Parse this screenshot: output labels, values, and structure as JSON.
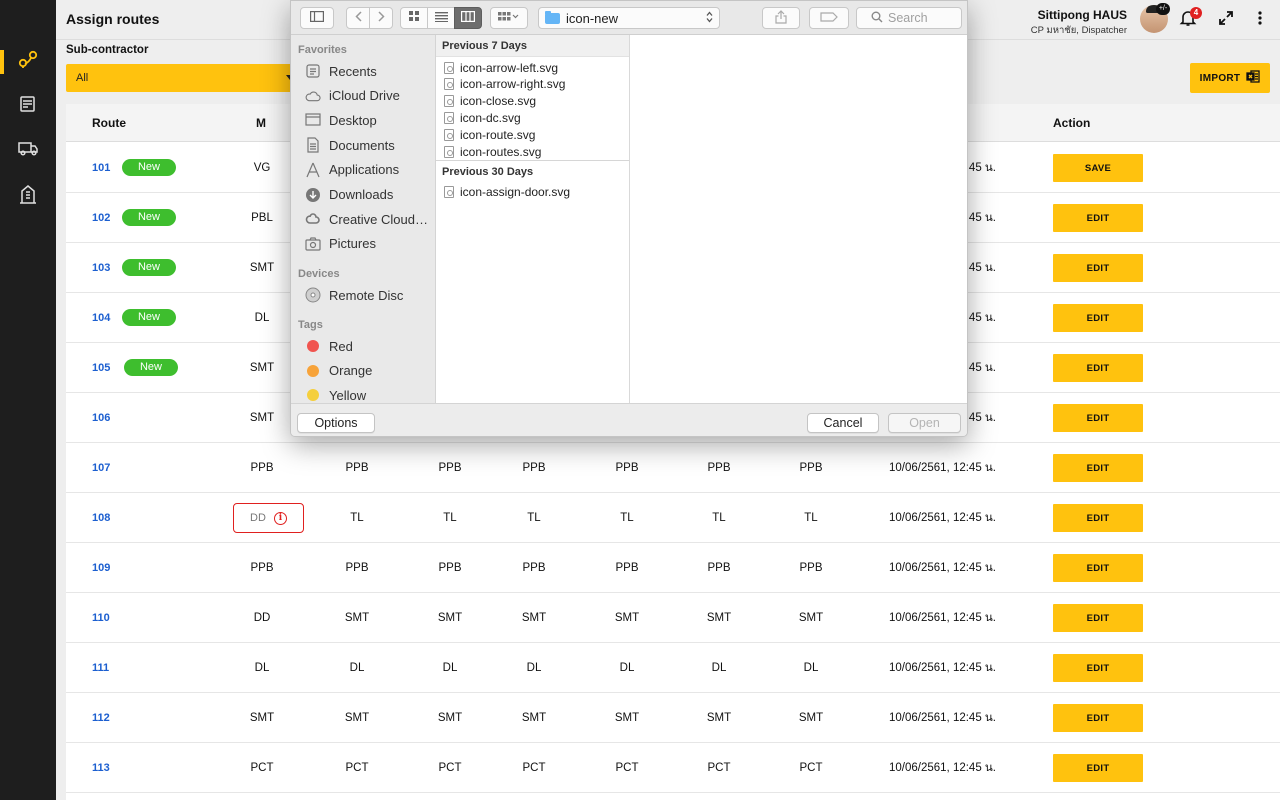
{
  "header": {
    "title": "Assign routes",
    "user_name": "Sittipong HAUS",
    "user_role": "CP มหาชัย, Dispatcher",
    "avatar_badge": "+/-",
    "notification_count": "4"
  },
  "filter": {
    "label": "Sub-contractor",
    "value": "All"
  },
  "import_label": "IMPORT",
  "table": {
    "headers": {
      "route": "Route",
      "m": "M",
      "action": "Action"
    },
    "rows": [
      {
        "route": "101",
        "badge": "New",
        "m": "VG",
        "days": [],
        "time": "10/06/2561, 12:45 น.",
        "action": "SAVE"
      },
      {
        "route": "102",
        "badge": "New",
        "m": "PBL",
        "days": [],
        "time": "10/06/2561, 12:45 น.",
        "action": "EDIT"
      },
      {
        "route": "103",
        "badge": "New",
        "m": "SMT",
        "days": [],
        "time": "10/06/2561, 12:45 น.",
        "action": "EDIT"
      },
      {
        "route": "104",
        "badge": "New",
        "m": "DL",
        "days": [],
        "time": "10/06/2561, 12:45 น.",
        "action": "EDIT"
      },
      {
        "route": "105",
        "badge": "New",
        "m": "SMT",
        "days": [],
        "time": "10/06/2561, 12:45 น.",
        "action": "EDIT"
      },
      {
        "route": "106",
        "badge": "",
        "m": "SMT",
        "days": [],
        "time": "10/06/2561, 12:45 น.",
        "action": "EDIT"
      },
      {
        "route": "107",
        "badge": "",
        "m": "PPB",
        "days": [
          "PPB",
          "PPB",
          "PPB",
          "PPB",
          "PPB",
          "PPB"
        ],
        "time": "10/06/2561, 12:45 น.",
        "action": "EDIT"
      },
      {
        "route": "108",
        "badge": "",
        "m": "DD",
        "error": true,
        "days": [
          "TL",
          "TL",
          "TL",
          "TL",
          "TL",
          "TL"
        ],
        "time": "10/06/2561, 12:45 น.",
        "action": "EDIT"
      },
      {
        "route": "109",
        "badge": "",
        "m": "PPB",
        "days": [
          "PPB",
          "PPB",
          "PPB",
          "PPB",
          "PPB",
          "PPB"
        ],
        "time": "10/06/2561, 12:45 น.",
        "action": "EDIT"
      },
      {
        "route": "110",
        "badge": "",
        "m": "DD",
        "days": [
          "SMT",
          "SMT",
          "SMT",
          "SMT",
          "SMT",
          "SMT"
        ],
        "time": "10/06/2561, 12:45 น.",
        "action": "EDIT"
      },
      {
        "route": "111",
        "badge": "",
        "m": "DL",
        "days": [
          "DL",
          "DL",
          "DL",
          "DL",
          "DL",
          "DL"
        ],
        "time": "10/06/2561, 12:45 น.",
        "action": "EDIT"
      },
      {
        "route": "112",
        "badge": "",
        "m": "SMT",
        "days": [
          "SMT",
          "SMT",
          "SMT",
          "SMT",
          "SMT",
          "SMT"
        ],
        "time": "10/06/2561, 12:45 น.",
        "action": "EDIT"
      },
      {
        "route": "113",
        "badge": "",
        "m": "PCT",
        "days": [
          "PCT",
          "PCT",
          "PCT",
          "PCT",
          "PCT",
          "PCT"
        ],
        "time": "10/06/2561, 12:45 น.",
        "action": "EDIT"
      }
    ]
  },
  "dialog": {
    "path": "icon-new",
    "search_placeholder": "Search",
    "sidebar": {
      "favorites_heading": "Favorites",
      "favorites": [
        {
          "label": "Recents",
          "icon": "recents-icon"
        },
        {
          "label": "iCloud Drive",
          "icon": "cloud-icon"
        },
        {
          "label": "Desktop",
          "icon": "desktop-icon"
        },
        {
          "label": "Documents",
          "icon": "documents-icon"
        },
        {
          "label": "Applications",
          "icon": "applications-icon"
        },
        {
          "label": "Downloads",
          "icon": "downloads-icon"
        },
        {
          "label": "Creative Cloud…",
          "icon": "creative-cloud-icon"
        },
        {
          "label": "Pictures",
          "icon": "pictures-icon"
        }
      ],
      "devices_heading": "Devices",
      "devices": [
        {
          "label": "Remote Disc",
          "icon": "disc-icon"
        }
      ],
      "tags_heading": "Tags",
      "tags": [
        {
          "label": "Red",
          "color": "#f0544f"
        },
        {
          "label": "Orange",
          "color": "#f7a33a"
        },
        {
          "label": "Yellow",
          "color": "#f5cf3c"
        }
      ]
    },
    "group1_heading": "Previous 7 Days",
    "group1_files": [
      "icon-arrow-left.svg",
      "icon-arrow-right.svg",
      "icon-close.svg",
      "icon-dc.svg",
      "icon-route.svg",
      "icon-routes.svg"
    ],
    "group2_heading": "Previous 30 Days",
    "group2_files": [
      "icon-assign-door.svg"
    ],
    "options_label": "Options",
    "cancel_label": "Cancel",
    "open_label": "Open"
  }
}
